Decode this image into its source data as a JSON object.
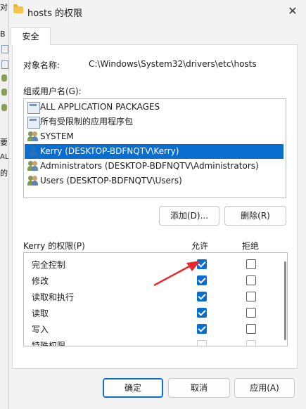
{
  "window": {
    "title": "hosts 的权限",
    "close_glyph": "✕"
  },
  "background_window": {
    "fragments": [
      "对",
      "B",
      "AL",
      "的",
      "要"
    ]
  },
  "tabs": [
    {
      "label": "安全"
    }
  ],
  "object": {
    "label": "对象名称:",
    "value": "C:\\Windows\\System32\\drivers\\etc\\hosts"
  },
  "groups": {
    "label": "组或用户名(G):",
    "items": [
      {
        "label": "ALL APPLICATION PACKAGES",
        "icon": "package-icon",
        "selected": false
      },
      {
        "label": "所有受限制的应用程序包",
        "icon": "package-icon",
        "selected": false
      },
      {
        "label": "SYSTEM",
        "icon": "users-icon",
        "selected": false
      },
      {
        "label": "Kerry (DESKTOP-BDFNQTV\\Kerry)",
        "icon": "user-icon",
        "selected": true
      },
      {
        "label": "Administrators (DESKTOP-BDFNQTV\\Administrators)",
        "icon": "users-icon",
        "selected": false
      },
      {
        "label": "Users (DESKTOP-BDFNQTV\\Users)",
        "icon": "users-icon",
        "selected": false
      }
    ],
    "add_button": "添加(D)...",
    "remove_button": "删除(R)"
  },
  "permissions": {
    "label": "Kerry 的权限(P)",
    "allow_header": "允许",
    "deny_header": "拒绝",
    "rows": [
      {
        "label": "完全控制",
        "allow": true,
        "deny": false
      },
      {
        "label": "修改",
        "allow": true,
        "deny": false
      },
      {
        "label": "读取和执行",
        "allow": true,
        "deny": false
      },
      {
        "label": "读取",
        "allow": true,
        "deny": false
      },
      {
        "label": "写入",
        "allow": true,
        "deny": false
      },
      {
        "label": "特殊权限",
        "allow": false,
        "deny": false
      }
    ]
  },
  "footer": {
    "ok": "确定",
    "cancel": "取消",
    "apply": "应用(A)"
  },
  "colors": {
    "accent": "#0a6ed1",
    "arrow": "#e8292a"
  }
}
